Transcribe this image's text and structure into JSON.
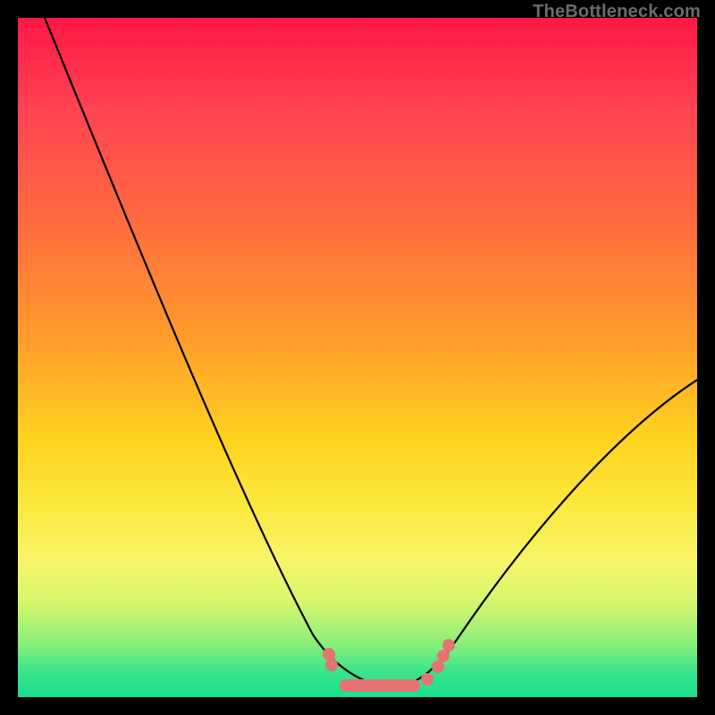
{
  "watermark": "TheBottleneck.com",
  "colors": {
    "background": "#000000",
    "gradient_top": "#ff1744",
    "gradient_mid": "#ffd21f",
    "gradient_bottom": "#18df90",
    "curve": "#000000",
    "markers": "#e57373"
  },
  "chart_data": {
    "type": "line",
    "title": "",
    "xlabel": "",
    "ylabel": "",
    "ylim": [
      0,
      100
    ],
    "xlim": [
      0,
      100
    ],
    "series": [
      {
        "name": "bottleneck-curve",
        "x": [
          4,
          10,
          18,
          26,
          34,
          42,
          47,
          50,
          54,
          58,
          62,
          70,
          80,
          90,
          100
        ],
        "values": [
          100,
          85,
          68,
          51,
          34,
          17,
          5,
          1,
          0,
          1,
          4,
          12,
          24,
          36,
          45
        ]
      }
    ],
    "markers": {
      "name": "highlighted-points",
      "x": [
        47,
        48,
        50,
        52,
        54,
        56,
        58,
        60,
        61,
        62
      ],
      "values": [
        4,
        3,
        1,
        0.5,
        0.3,
        0.5,
        1,
        2.5,
        3.5,
        5
      ]
    }
  }
}
